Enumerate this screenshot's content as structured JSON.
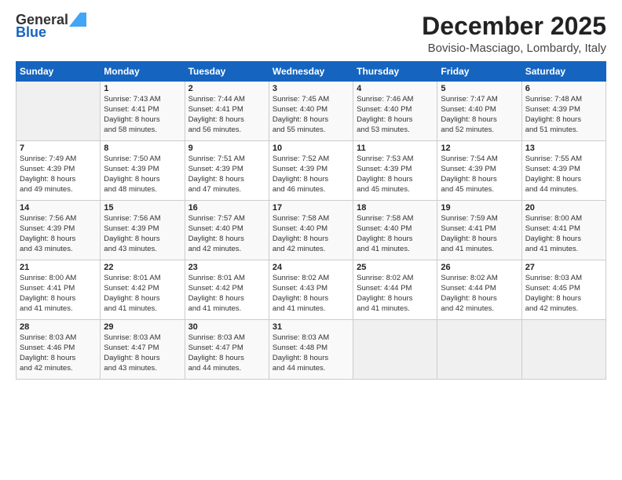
{
  "logo": {
    "general": "General",
    "blue": "Blue"
  },
  "header": {
    "title": "December 2025",
    "subtitle": "Bovisio-Masciago, Lombardy, Italy"
  },
  "weekdays": [
    "Sunday",
    "Monday",
    "Tuesday",
    "Wednesday",
    "Thursday",
    "Friday",
    "Saturday"
  ],
  "weeks": [
    [
      {
        "day": "",
        "info": ""
      },
      {
        "day": "1",
        "info": "Sunrise: 7:43 AM\nSunset: 4:41 PM\nDaylight: 8 hours\nand 58 minutes."
      },
      {
        "day": "2",
        "info": "Sunrise: 7:44 AM\nSunset: 4:41 PM\nDaylight: 8 hours\nand 56 minutes."
      },
      {
        "day": "3",
        "info": "Sunrise: 7:45 AM\nSunset: 4:40 PM\nDaylight: 8 hours\nand 55 minutes."
      },
      {
        "day": "4",
        "info": "Sunrise: 7:46 AM\nSunset: 4:40 PM\nDaylight: 8 hours\nand 53 minutes."
      },
      {
        "day": "5",
        "info": "Sunrise: 7:47 AM\nSunset: 4:40 PM\nDaylight: 8 hours\nand 52 minutes."
      },
      {
        "day": "6",
        "info": "Sunrise: 7:48 AM\nSunset: 4:39 PM\nDaylight: 8 hours\nand 51 minutes."
      }
    ],
    [
      {
        "day": "7",
        "info": "Sunrise: 7:49 AM\nSunset: 4:39 PM\nDaylight: 8 hours\nand 49 minutes."
      },
      {
        "day": "8",
        "info": "Sunrise: 7:50 AM\nSunset: 4:39 PM\nDaylight: 8 hours\nand 48 minutes."
      },
      {
        "day": "9",
        "info": "Sunrise: 7:51 AM\nSunset: 4:39 PM\nDaylight: 8 hours\nand 47 minutes."
      },
      {
        "day": "10",
        "info": "Sunrise: 7:52 AM\nSunset: 4:39 PM\nDaylight: 8 hours\nand 46 minutes."
      },
      {
        "day": "11",
        "info": "Sunrise: 7:53 AM\nSunset: 4:39 PM\nDaylight: 8 hours\nand 45 minutes."
      },
      {
        "day": "12",
        "info": "Sunrise: 7:54 AM\nSunset: 4:39 PM\nDaylight: 8 hours\nand 45 minutes."
      },
      {
        "day": "13",
        "info": "Sunrise: 7:55 AM\nSunset: 4:39 PM\nDaylight: 8 hours\nand 44 minutes."
      }
    ],
    [
      {
        "day": "14",
        "info": "Sunrise: 7:56 AM\nSunset: 4:39 PM\nDaylight: 8 hours\nand 43 minutes."
      },
      {
        "day": "15",
        "info": "Sunrise: 7:56 AM\nSunset: 4:39 PM\nDaylight: 8 hours\nand 43 minutes."
      },
      {
        "day": "16",
        "info": "Sunrise: 7:57 AM\nSunset: 4:40 PM\nDaylight: 8 hours\nand 42 minutes."
      },
      {
        "day": "17",
        "info": "Sunrise: 7:58 AM\nSunset: 4:40 PM\nDaylight: 8 hours\nand 42 minutes."
      },
      {
        "day": "18",
        "info": "Sunrise: 7:58 AM\nSunset: 4:40 PM\nDaylight: 8 hours\nand 41 minutes."
      },
      {
        "day": "19",
        "info": "Sunrise: 7:59 AM\nSunset: 4:41 PM\nDaylight: 8 hours\nand 41 minutes."
      },
      {
        "day": "20",
        "info": "Sunrise: 8:00 AM\nSunset: 4:41 PM\nDaylight: 8 hours\nand 41 minutes."
      }
    ],
    [
      {
        "day": "21",
        "info": "Sunrise: 8:00 AM\nSunset: 4:41 PM\nDaylight: 8 hours\nand 41 minutes."
      },
      {
        "day": "22",
        "info": "Sunrise: 8:01 AM\nSunset: 4:42 PM\nDaylight: 8 hours\nand 41 minutes."
      },
      {
        "day": "23",
        "info": "Sunrise: 8:01 AM\nSunset: 4:42 PM\nDaylight: 8 hours\nand 41 minutes."
      },
      {
        "day": "24",
        "info": "Sunrise: 8:02 AM\nSunset: 4:43 PM\nDaylight: 8 hours\nand 41 minutes."
      },
      {
        "day": "25",
        "info": "Sunrise: 8:02 AM\nSunset: 4:44 PM\nDaylight: 8 hours\nand 41 minutes."
      },
      {
        "day": "26",
        "info": "Sunrise: 8:02 AM\nSunset: 4:44 PM\nDaylight: 8 hours\nand 42 minutes."
      },
      {
        "day": "27",
        "info": "Sunrise: 8:03 AM\nSunset: 4:45 PM\nDaylight: 8 hours\nand 42 minutes."
      }
    ],
    [
      {
        "day": "28",
        "info": "Sunrise: 8:03 AM\nSunset: 4:46 PM\nDaylight: 8 hours\nand 42 minutes."
      },
      {
        "day": "29",
        "info": "Sunrise: 8:03 AM\nSunset: 4:47 PM\nDaylight: 8 hours\nand 43 minutes."
      },
      {
        "day": "30",
        "info": "Sunrise: 8:03 AM\nSunset: 4:47 PM\nDaylight: 8 hours\nand 44 minutes."
      },
      {
        "day": "31",
        "info": "Sunrise: 8:03 AM\nSunset: 4:48 PM\nDaylight: 8 hours\nand 44 minutes."
      },
      {
        "day": "",
        "info": ""
      },
      {
        "day": "",
        "info": ""
      },
      {
        "day": "",
        "info": ""
      }
    ]
  ]
}
